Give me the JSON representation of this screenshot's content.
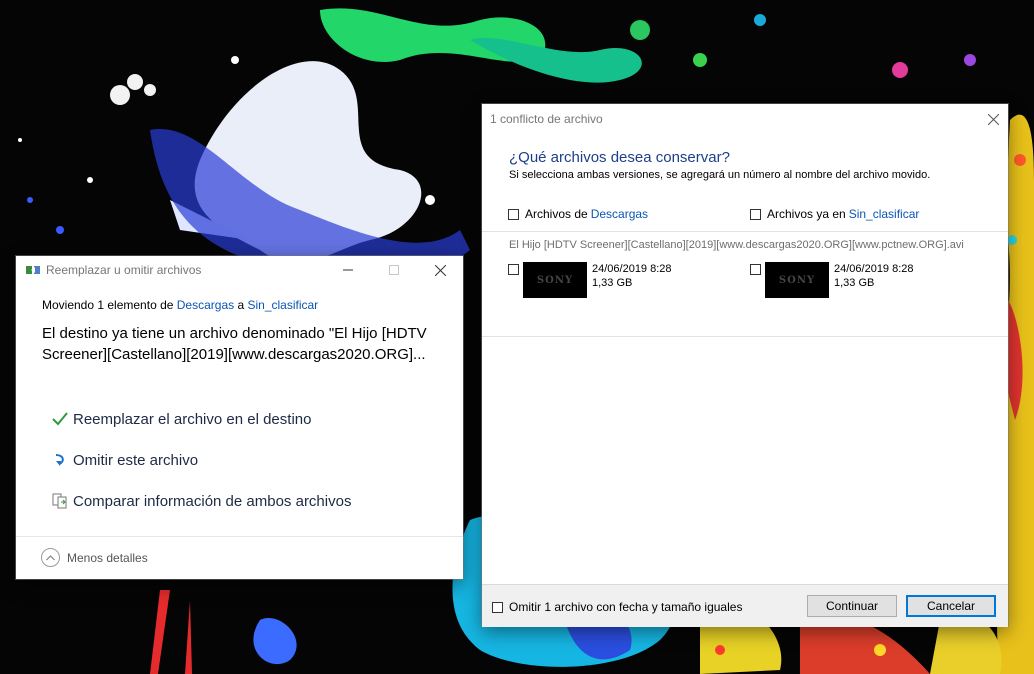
{
  "replace_dialog": {
    "title": "Reemplazar u omitir archivos",
    "moving_prefix": "Moviendo 1 elemento de ",
    "source_folder": "Descargas",
    "moving_middle": " a ",
    "dest_folder": "Sin_clasificar",
    "message": "El destino ya tiene un archivo denominado \"El Hijo [HDTV Screener][Castellano][2019][www.descargas2020.ORG]...",
    "options": [
      {
        "label": "Reemplazar el archivo en el destino",
        "icon": "checkmark-icon"
      },
      {
        "label": "Omitir este archivo",
        "icon": "skip-arrow-icon"
      },
      {
        "label": "Comparar información de ambos archivos",
        "icon": "compare-files-icon"
      }
    ],
    "less_details": "Menos detalles"
  },
  "conflict_dialog": {
    "title": "1 conflicto de archivo",
    "question": "¿Qué archivos desea conservar?",
    "subtext": "Si selecciona ambas versiones, se agregará un número al nombre del archivo movido.",
    "left_header_prefix": "Archivos de ",
    "left_header_link": "Descargas",
    "right_header_prefix": "Archivos ya en ",
    "right_header_link": "Sin_clasificar",
    "file_name": "El Hijo [HDTV Screener][Castellano][2019][www.descargas2020.ORG][www.pctnew.ORG].avi",
    "left_file": {
      "date": "24/06/2019 8:28",
      "size": "1,33 GB",
      "thumb_text": "SONY"
    },
    "right_file": {
      "date": "24/06/2019 8:28",
      "size": "1,33 GB",
      "thumb_text": "SONY"
    },
    "skip_same": "Omitir 1 archivo con fecha y tamaño iguales",
    "continue_label": "Continuar",
    "cancel_label": "Cancelar"
  },
  "colors": {
    "link": "#0b55b4",
    "question": "#1d3f8a",
    "check_green": "#2e9a3f",
    "skip_blue": "#1a73c9",
    "default_button_border": "#0078d7"
  }
}
